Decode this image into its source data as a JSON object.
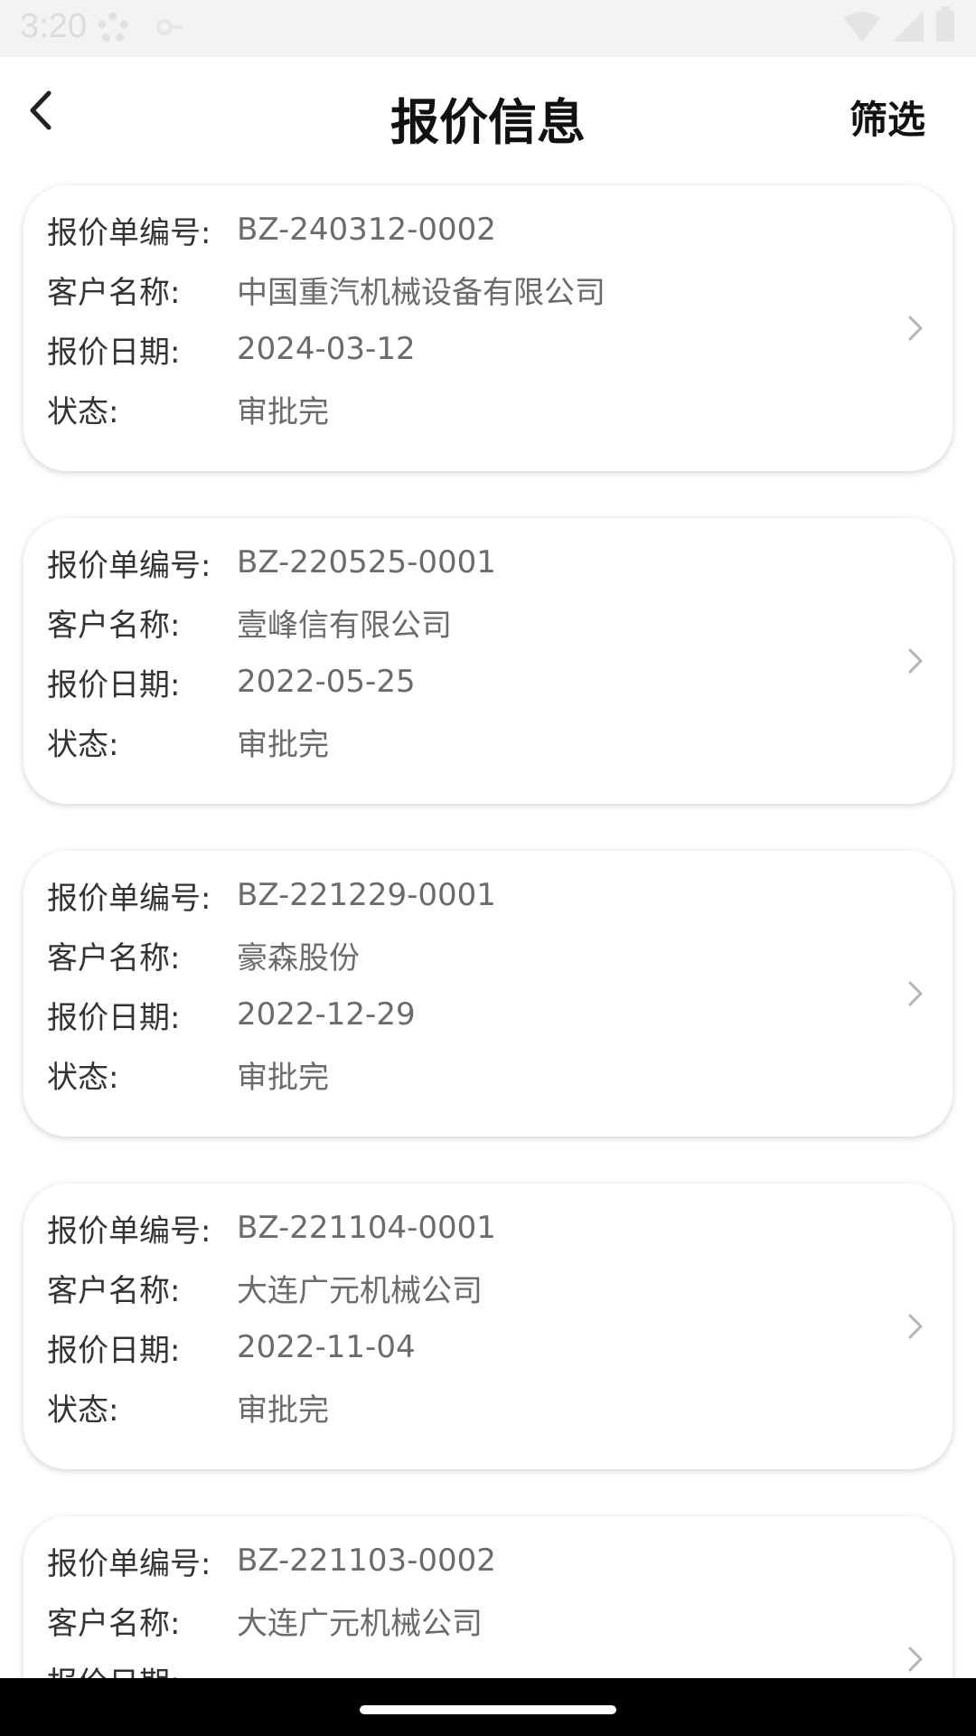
{
  "status_bar": {
    "time": "3:20"
  },
  "header": {
    "title": "报价信息",
    "filter_label": "筛选"
  },
  "labels": {
    "quote_no": "报价单编号:",
    "customer": "客户名称:",
    "date": "报价日期:",
    "status": "状态:"
  },
  "quotes": [
    {
      "quote_no": "BZ-240312-0002",
      "customer": "中国重汽机械设备有限公司",
      "date": "2024-03-12",
      "status": "审批完"
    },
    {
      "quote_no": "BZ-220525-0001",
      "customer": "壹峰信有限公司",
      "date": "2022-05-25",
      "status": "审批完"
    },
    {
      "quote_no": "BZ-221229-0001",
      "customer": "豪森股份",
      "date": "2022-12-29",
      "status": "审批完"
    },
    {
      "quote_no": "BZ-221104-0001",
      "customer": "大连广元机械公司",
      "date": "2022-11-04",
      "status": "审批完"
    },
    {
      "quote_no": "BZ-221103-0002",
      "customer": "大连广元机械公司",
      "date": "",
      "status": ""
    }
  ],
  "colors": {
    "label": "#333333",
    "value": "#6b6b6b",
    "chevron": "#b5b5b5",
    "nav_bar": "#000000"
  },
  "icons": {
    "back": "chevron-left-icon",
    "row_arrow": "chevron-right-icon"
  }
}
